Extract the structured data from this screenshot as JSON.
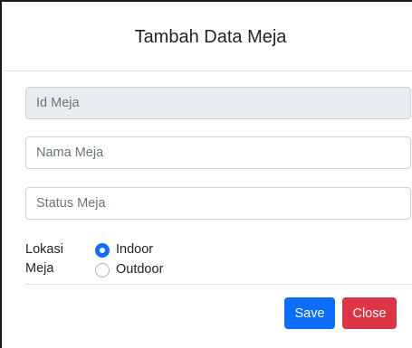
{
  "modal": {
    "title": "Tambah Data Meja"
  },
  "form": {
    "id_meja": {
      "placeholder": "Id Meja",
      "value": ""
    },
    "nama_meja": {
      "placeholder": "Nama Meja",
      "value": ""
    },
    "status_meja": {
      "placeholder": "Status Meja",
      "value": ""
    },
    "lokasi": {
      "label": "Lokasi Meja",
      "options": [
        {
          "label": "Indoor",
          "checked": true
        },
        {
          "label": "Outdoor",
          "checked": false
        }
      ]
    }
  },
  "footer": {
    "save_label": "Save",
    "close_label": "Close"
  },
  "colors": {
    "primary": "#0d6efd",
    "danger": "#dc3545",
    "disabled_bg": "#e9ecef",
    "border": "#ced4da"
  }
}
